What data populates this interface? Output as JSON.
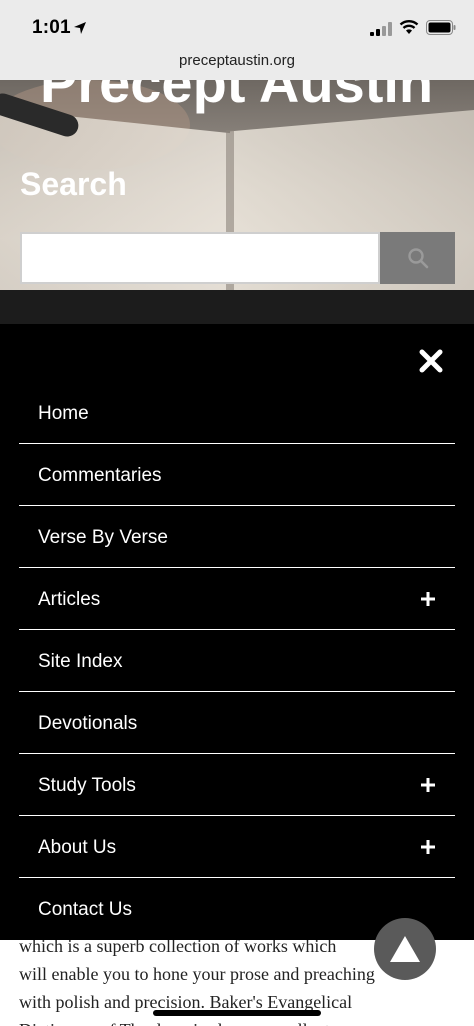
{
  "status_bar": {
    "time": "1:01"
  },
  "browser": {
    "url": "preceptaustin.org"
  },
  "hero": {
    "site_title": "Precept Austin",
    "search_label": "Search",
    "search_value": ""
  },
  "menu": {
    "items": [
      {
        "label": "Home",
        "expandable": false
      },
      {
        "label": "Commentaries",
        "expandable": false
      },
      {
        "label": "Verse By Verse",
        "expandable": false
      },
      {
        "label": "Articles",
        "expandable": true
      },
      {
        "label": "Site Index",
        "expandable": false
      },
      {
        "label": "Devotionals",
        "expandable": false
      },
      {
        "label": "Study Tools",
        "expandable": true
      },
      {
        "label": "About Us",
        "expandable": true
      },
      {
        "label": "Contact Us",
        "expandable": false
      }
    ]
  },
  "content": {
    "lines": [
      "which is a superb collection of works which",
      "will enable you to hone your prose and preaching",
      "with polish and precision. Baker's Evangelical",
      "Dictionary of Theology is also an excellent"
    ]
  },
  "icons": {
    "close": "close-icon",
    "search": "search-icon",
    "expand": "plus-icon",
    "scroll_top": "arrow-up-icon"
  },
  "colors": {
    "menu_bg": "#000000",
    "search_button": "#7a7a7a",
    "status_bg": "#ebebeb"
  }
}
